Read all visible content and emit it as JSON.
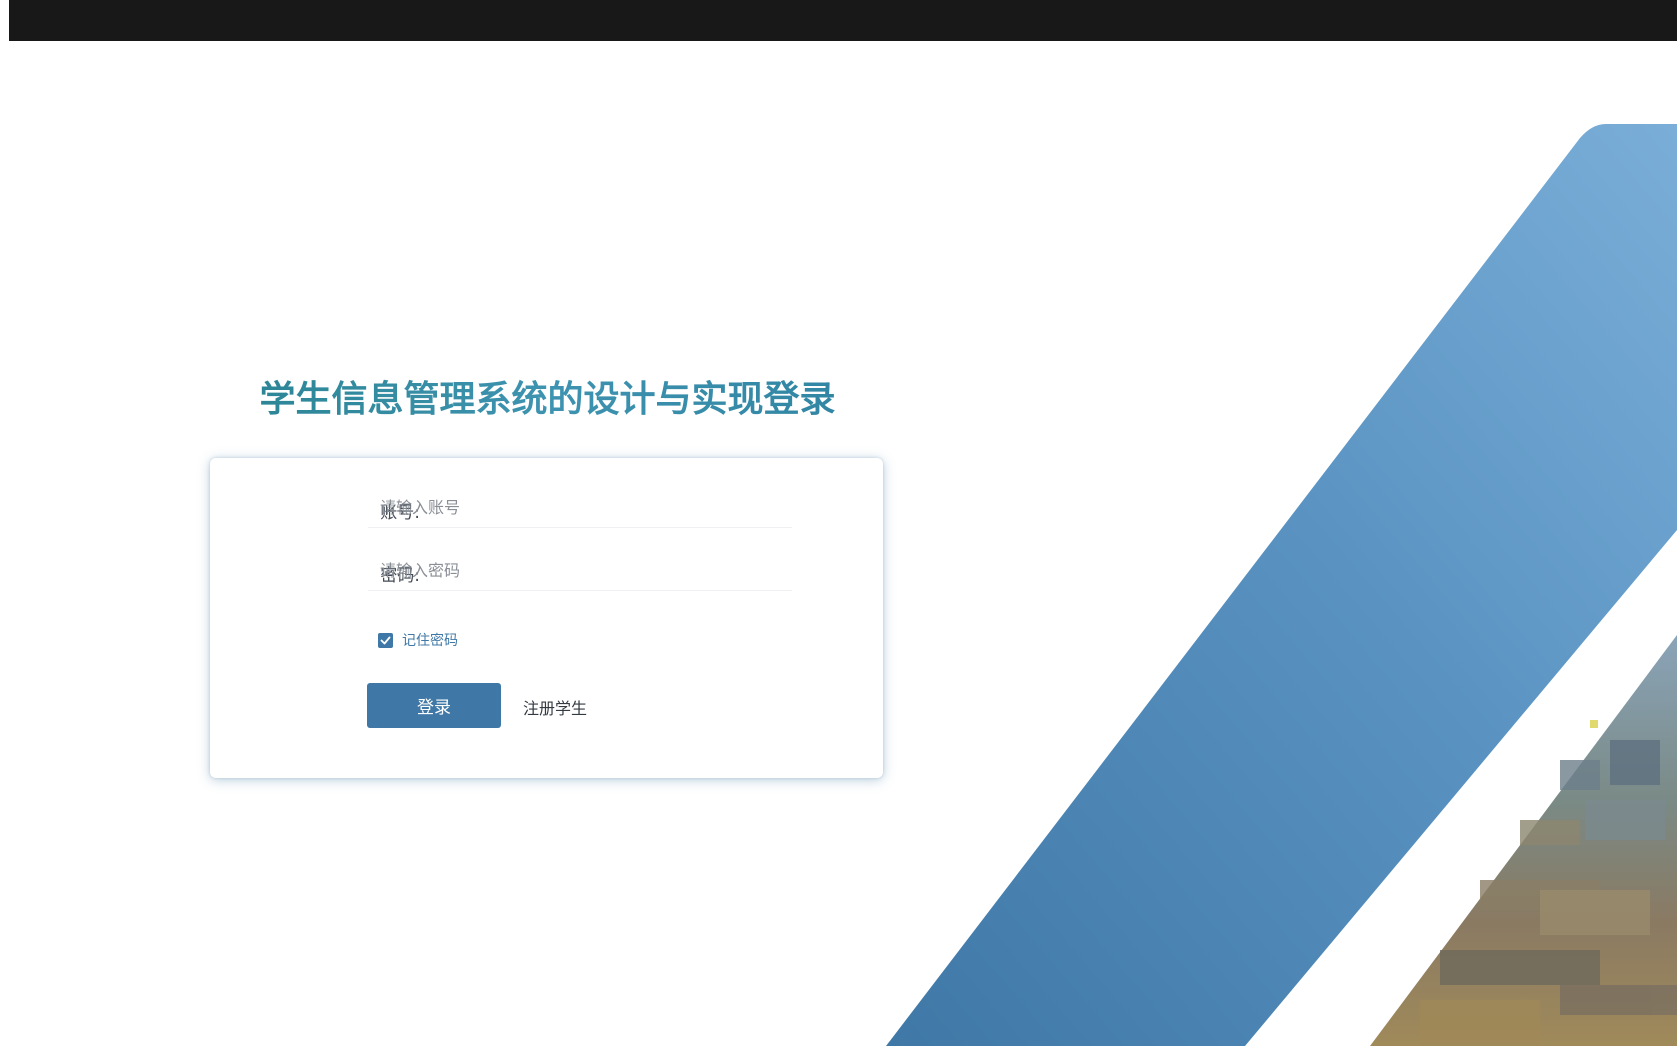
{
  "page": {
    "title": "学生信息管理系统的设计与实现登录"
  },
  "login_form": {
    "account_label": "账号:",
    "account_placeholder": "请输入账号",
    "account_value": "",
    "password_label": "密码:",
    "password_placeholder": "请输入密码",
    "password_value": "",
    "remember_label": "记住密码",
    "remember_checked": true,
    "login_button": "登录",
    "register_link": "注册学生"
  },
  "theme": {
    "accent": "#3f78a6",
    "title_color": "#2a8492",
    "top_bar": "#181818",
    "stripe_light": "#7aaed8",
    "stripe_dark": "#3f78a6"
  }
}
